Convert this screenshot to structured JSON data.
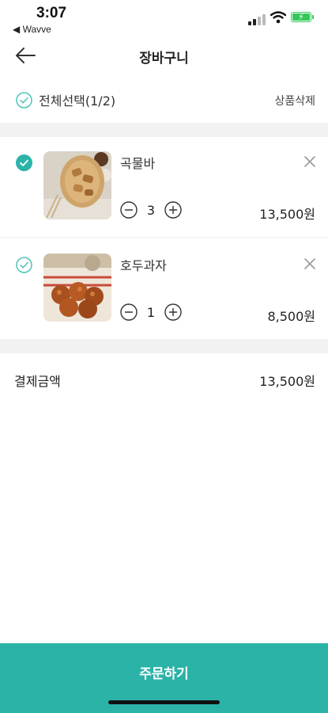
{
  "status_bar": {
    "time": "3:07",
    "back_app": "◀ Wavve"
  },
  "header": {
    "title": "장바구니",
    "back_icon": "arrow-left-icon"
  },
  "select_all": {
    "label": "전체선택(1/2)",
    "checked": false,
    "delete_label": "상품삭제"
  },
  "cart_items": [
    {
      "name": "곡물바",
      "quantity": "3",
      "price": "13,500원",
      "checked": true
    },
    {
      "name": "호두과자",
      "quantity": "1",
      "price": "8,500원",
      "checked": false
    }
  ],
  "total": {
    "label": "결제금액",
    "value": "13,500원"
  },
  "order_button": {
    "label": "주문하기"
  },
  "colors": {
    "accent": "#2bb3a8",
    "check_outline": "#4cc3b9",
    "divider": "#f2f2f2"
  }
}
